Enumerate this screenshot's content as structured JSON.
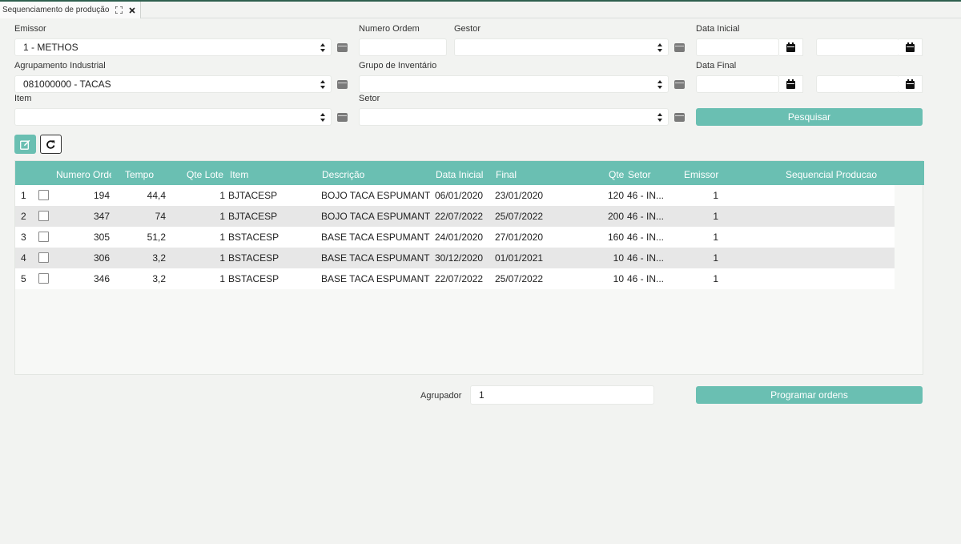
{
  "tab": {
    "title": "Sequenciamento de produção"
  },
  "form": {
    "emissor": {
      "label": "Emissor",
      "value": "1 - METHOS"
    },
    "numero_ordem": {
      "label": "Numero Ordem",
      "value": ""
    },
    "gestor": {
      "label": "Gestor",
      "value": ""
    },
    "data_inicial": {
      "label": "Data Inicial",
      "from": "",
      "to": ""
    },
    "agrupamento": {
      "label": "Agrupamento Industrial",
      "value": "081000000 - TACAS"
    },
    "grupo_inventario": {
      "label": "Grupo de Inventário",
      "value": ""
    },
    "data_final": {
      "label": "Data Final",
      "from": "",
      "to": ""
    },
    "item": {
      "label": "Item",
      "value": ""
    },
    "setor": {
      "label": "Setor",
      "value": ""
    },
    "search_button": "Pesquisar"
  },
  "toolbar": {
    "edit_icon": "edit-icon",
    "refresh_icon": "refresh-icon"
  },
  "table": {
    "headers": [
      "Numero Ordem",
      "Tempo",
      "Qte Lote",
      "Item",
      "Descrição",
      "Data Inicial",
      "Final",
      "Qte",
      "Setor",
      "Emissor",
      "Sequencial Producao"
    ],
    "rows": [
      {
        "n": "1",
        "numero": "194",
        "tempo": "44,4",
        "qte_lote": "1",
        "item": "BJTACESP",
        "descricao": "BOJO TACA ESPUMANTE",
        "data_inicial": "06/01/2020",
        "final": "23/01/2020",
        "qte": "120",
        "setor": "46 - IN...",
        "emissor": "1",
        "sequencial": ""
      },
      {
        "n": "2",
        "numero": "347",
        "tempo": "74",
        "qte_lote": "1",
        "item": "BJTACESP",
        "descricao": "BOJO TACA ESPUMANTE",
        "data_inicial": "22/07/2022",
        "final": "25/07/2022",
        "qte": "200",
        "setor": "46 - IN...",
        "emissor": "1",
        "sequencial": ""
      },
      {
        "n": "3",
        "numero": "305",
        "tempo": "51,2",
        "qte_lote": "1",
        "item": "BSTACESP",
        "descricao": "BASE TACA ESPUMANTE",
        "data_inicial": "24/01/2020",
        "final": "27/01/2020",
        "qte": "160",
        "setor": "46 - IN...",
        "emissor": "1",
        "sequencial": ""
      },
      {
        "n": "4",
        "numero": "306",
        "tempo": "3,2",
        "qte_lote": "1",
        "item": "BSTACESP",
        "descricao": "BASE TACA ESPUMANTE",
        "data_inicial": "30/12/2020",
        "final": "01/01/2021",
        "qte": "10",
        "setor": "46 - IN...",
        "emissor": "1",
        "sequencial": ""
      },
      {
        "n": "5",
        "numero": "346",
        "tempo": "3,2",
        "qte_lote": "1",
        "item": "BSTACESP",
        "descricao": "BASE TACA ESPUMANTE",
        "data_inicial": "22/07/2022",
        "final": "25/07/2022",
        "qte": "10",
        "setor": "46 - IN...",
        "emissor": "1",
        "sequencial": ""
      }
    ]
  },
  "footer": {
    "agrupador_label": "Agrupador",
    "agrupador_value": "1",
    "program_button": "Programar ordens"
  },
  "colors": {
    "accent": "#6abfb2",
    "row_alt": "#e7e7e7",
    "background": "#f2f3f1"
  }
}
